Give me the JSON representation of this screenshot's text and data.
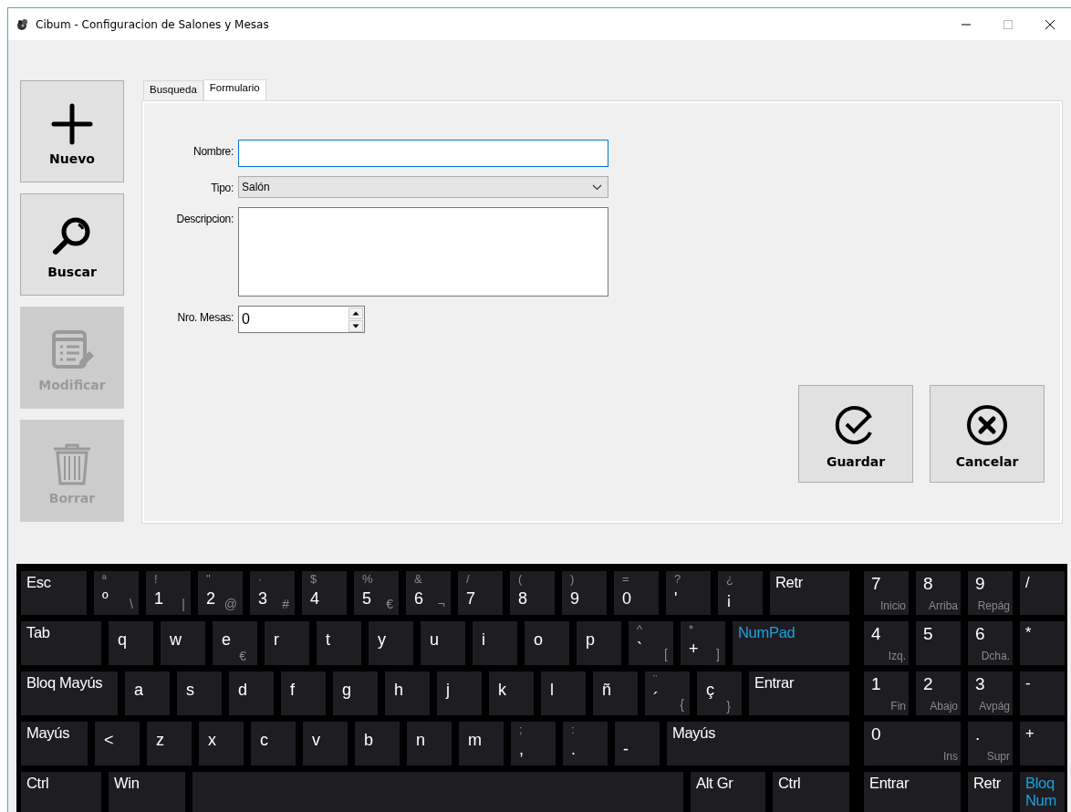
{
  "window": {
    "title": "Cibum - Configuracion de Salones y Mesas"
  },
  "toolbar": [
    {
      "label": "Nuevo",
      "kind": "plus",
      "disabled": false
    },
    {
      "label": "Buscar",
      "kind": "search",
      "disabled": false
    },
    {
      "label": "Modificar",
      "kind": "edit",
      "disabled": true
    },
    {
      "label": "Borrar",
      "kind": "trash",
      "disabled": true
    }
  ],
  "tabs": [
    {
      "label": "Busqueda",
      "selected": false
    },
    {
      "label": "Formulario",
      "selected": true
    }
  ],
  "form": {
    "fields": [
      {
        "kind": "text",
        "label": "Nombre:",
        "focused": true
      },
      {
        "kind": "select",
        "label": "Tipo:",
        "value": "Salón",
        "focused": false
      },
      {
        "kind": "textarea",
        "label": "Descripcion:",
        "focused": false
      },
      {
        "kind": "spinner",
        "label": "Nro. Mesas:",
        "value": "0",
        "focused": false
      }
    ],
    "actions": [
      {
        "label": "Guardar",
        "kind": "check"
      },
      {
        "label": "Cancelar",
        "kind": "cancel"
      }
    ]
  },
  "keyboard": {
    "rows": [
      {
        "keys": [
          {
            "kind": "fn",
            "main": "Esc"
          },
          {
            "kind": "char",
            "shift": "ª",
            "main": "º",
            "alt": "\\"
          },
          {
            "kind": "char",
            "shift": "!",
            "main": "1",
            "alt": "|"
          },
          {
            "kind": "char",
            "shift": "\"",
            "main": "2",
            "alt": "@"
          },
          {
            "kind": "char",
            "shift": "·",
            "main": "3",
            "alt": "#"
          },
          {
            "kind": "char",
            "shift": "$",
            "main": "4"
          },
          {
            "kind": "char",
            "shift": "%",
            "main": "5",
            "alt": "€"
          },
          {
            "kind": "char",
            "shift": "&",
            "main": "6",
            "alt": "¬"
          },
          {
            "kind": "char",
            "shift": "/",
            "main": "7"
          },
          {
            "kind": "char",
            "shift": "(",
            "main": "8"
          },
          {
            "kind": "char",
            "shift": ")",
            "main": "9"
          },
          {
            "kind": "char",
            "shift": "=",
            "main": "0"
          },
          {
            "kind": "char",
            "shift": "?",
            "main": "'"
          },
          {
            "kind": "char",
            "shift": "¿",
            "main": "¡"
          },
          {
            "kind": "fn",
            "main": "Retr"
          }
        ]
      },
      {
        "keys": [
          {
            "kind": "fn",
            "main": "Tab"
          },
          {
            "kind": "letter",
            "main": "q"
          },
          {
            "kind": "letter",
            "main": "w"
          },
          {
            "kind": "letter",
            "main": "e",
            "alt": "€"
          },
          {
            "kind": "letter",
            "main": "r"
          },
          {
            "kind": "letter",
            "main": "t"
          },
          {
            "kind": "letter",
            "main": "y"
          },
          {
            "kind": "letter",
            "main": "u"
          },
          {
            "kind": "letter",
            "main": "i"
          },
          {
            "kind": "letter",
            "main": "o"
          },
          {
            "kind": "letter",
            "main": "p"
          },
          {
            "kind": "char",
            "shift": "^",
            "main": "`",
            "alt": "["
          },
          {
            "kind": "char",
            "shift": "*",
            "main": "+",
            "alt": "]"
          },
          {
            "kind": "toggle",
            "main": "NumPad"
          }
        ]
      },
      {
        "keys": [
          {
            "kind": "fn",
            "main": "Bloq Mayús"
          },
          {
            "kind": "letter",
            "main": "a"
          },
          {
            "kind": "letter",
            "main": "s"
          },
          {
            "kind": "letter",
            "main": "d"
          },
          {
            "kind": "letter",
            "main": "f"
          },
          {
            "kind": "letter",
            "main": "g"
          },
          {
            "kind": "letter",
            "main": "h"
          },
          {
            "kind": "letter",
            "main": "j"
          },
          {
            "kind": "letter",
            "main": "k"
          },
          {
            "kind": "letter",
            "main": "l"
          },
          {
            "kind": "letter",
            "main": "ñ"
          },
          {
            "kind": "char",
            "shift": "¨",
            "main": "´",
            "alt": "{"
          },
          {
            "kind": "letter",
            "main": "ç",
            "alt": "}"
          },
          {
            "kind": "fn",
            "main": "Entrar"
          }
        ]
      },
      {
        "keys": [
          {
            "kind": "fn",
            "main": "Mayús"
          },
          {
            "kind": "letter",
            "main": "<"
          },
          {
            "kind": "letter",
            "main": "z"
          },
          {
            "kind": "letter",
            "main": "x"
          },
          {
            "kind": "letter",
            "main": "c"
          },
          {
            "kind": "letter",
            "main": "v"
          },
          {
            "kind": "letter",
            "main": "b"
          },
          {
            "kind": "letter",
            "main": "n"
          },
          {
            "kind": "letter",
            "main": "m"
          },
          {
            "kind": "char",
            "shift": ";",
            "main": ","
          },
          {
            "kind": "char",
            "shift": ":",
            "main": "."
          },
          {
            "kind": "char",
            "main": "-"
          },
          {
            "kind": "fn",
            "main": "Mayús"
          }
        ]
      },
      {
        "keys": [
          {
            "kind": "fn",
            "main": "Ctrl"
          },
          {
            "kind": "fn",
            "main": "Win"
          },
          {
            "kind": "space"
          },
          {
            "kind": "fn",
            "main": "Alt Gr"
          },
          {
            "kind": "fn",
            "main": "Ctrl"
          }
        ]
      }
    ],
    "numpad": [
      {
        "kind": "num",
        "main": "7",
        "alt": "Inicio"
      },
      {
        "kind": "num",
        "main": "8",
        "alt": "Arriba"
      },
      {
        "kind": "num",
        "main": "9",
        "alt": "Repág"
      },
      {
        "kind": "fn",
        "main": "/"
      },
      {
        "kind": "num",
        "main": "4",
        "alt": "Izq."
      },
      {
        "kind": "num",
        "main": "5"
      },
      {
        "kind": "num",
        "main": "6",
        "alt": "Dcha."
      },
      {
        "kind": "fn",
        "main": "*"
      },
      {
        "kind": "num",
        "main": "1",
        "alt": "Fin"
      },
      {
        "kind": "num",
        "main": "2",
        "alt": "Abajo"
      },
      {
        "kind": "num",
        "main": "3",
        "alt": "Avpág"
      },
      {
        "kind": "fn",
        "main": "-"
      },
      {
        "kind": "wide",
        "main": "0",
        "alt": "Ins"
      },
      {
        "kind": "num",
        "main": ".",
        "alt": "Supr"
      },
      {
        "kind": "fn",
        "main": "+"
      },
      {
        "kind": "widefn",
        "main": "Entrar"
      },
      {
        "kind": "fn",
        "main": "Retr"
      },
      {
        "kind": "toggle",
        "main": "Bloq Num"
      }
    ]
  }
}
